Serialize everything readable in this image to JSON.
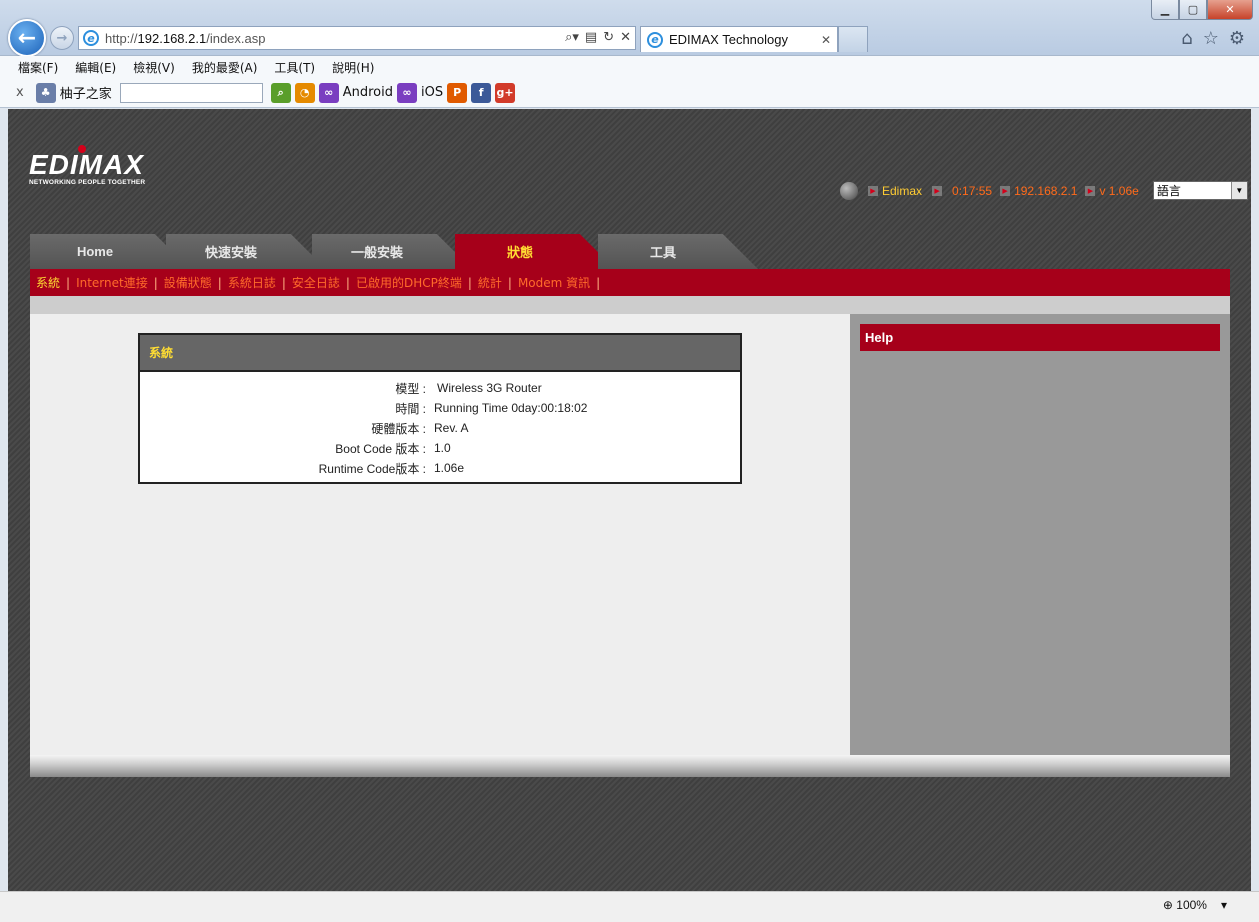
{
  "browser": {
    "url_prefix": "http://",
    "url_host": "192.168.2.1",
    "url_path": "/index.asp",
    "tab_title": "EDIMAX Technology",
    "menu": [
      "檔案(F)",
      "編輯(E)",
      "檢視(V)",
      "我的最愛(A)",
      "工具(T)",
      "說明(H)"
    ],
    "favorites": {
      "site_label": "柚子之家",
      "android_label": "Android",
      "ios_label": "iOS"
    },
    "zoom": "100%"
  },
  "router": {
    "logo_text": "EDIMAX",
    "logo_tagline": "NETWORKING PEOPLE TOGETHER",
    "status": {
      "brand": "Edimax",
      "time": "0:17:55",
      "ip": "192.168.2.1",
      "version": "v 1.06e",
      "language": "語言"
    },
    "tabs": [
      "Home",
      "快速安裝",
      "一般安裝",
      "狀態",
      "工具"
    ],
    "active_tab": "狀態",
    "subnav": [
      "系統",
      "Internet連接",
      "設備狀態",
      "系統日誌",
      "安全日誌",
      "已啟用的DHCP終端",
      "統計",
      "Modem 資訊"
    ],
    "panel_title": "系統",
    "rows": [
      {
        "label": "模型 :",
        "value": "Wireless 3G Router"
      },
      {
        "label": "時間 :",
        "value": "Running Time 0day:00:18:02"
      },
      {
        "label": "硬體版本 :",
        "value": "Rev. A"
      },
      {
        "label": "Boot Code 版本 :",
        "value": "1.0"
      },
      {
        "label": "Runtime Code版本 :",
        "value": "1.06e"
      }
    ],
    "help_title": "Help"
  },
  "colors": {
    "brand_red": "#a6001a",
    "active_yellow": "#ffdd33",
    "link_orange": "#ff6a2a"
  }
}
